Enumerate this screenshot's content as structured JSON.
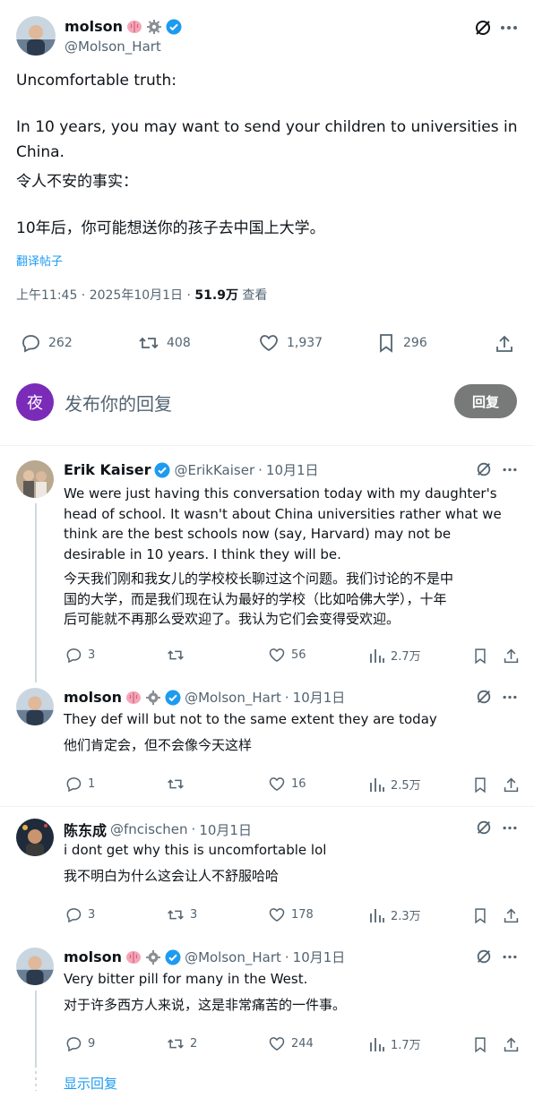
{
  "main_post": {
    "name": "molson",
    "handle": "@Molson_Hart",
    "text_en_1": "Uncomfortable truth:",
    "text_en_2a": "In 10 years, you may want to send your children to universities in",
    "text_en_2b": "China.",
    "text_zh_1": "令人不安的事实：",
    "text_zh_2": "10年后，你可能想送你的孩子去中国上大学。",
    "translate_label": "翻译帖子",
    "time": "上午11:45 · 2025年10月1日 · ",
    "views_count": "51.9万",
    "views_label": " 查看",
    "stats": {
      "replies": "262",
      "reposts": "408",
      "likes": "1,937",
      "bookmarks": "296"
    }
  },
  "reply_box": {
    "avatar_char": "夜",
    "placeholder": "发布你的回复",
    "button": "回复"
  },
  "replies": [
    {
      "name": "Erik Kaiser",
      "handle": "@ErikKaiser",
      "sep": "·",
      "date": "10月1日",
      "lines_en": [
        "We were just having this conversation today with my daughter's",
        "head of school. It wasn't about China universities rather what we",
        "think are the best schools now (say, Harvard) may not be",
        "desirable in 10 years. I think they will be."
      ],
      "lines_zh": [
        "今天我们刚和我女儿的学校校长聊过这个问题。我们讨论的不是中",
        "国的大学，而是我们现在认为最好的学校（比如哈佛大学），十年",
        "后可能就不再那么受欢迎了。我认为它们会变得受欢迎。"
      ],
      "stats": {
        "replies": "3",
        "reposts": "",
        "likes": "56",
        "views": "2.7万"
      }
    },
    {
      "name": "molson",
      "handle": "@Molson_Hart",
      "sep": "·",
      "date": "10月1日",
      "lines_en": [
        "They def will but not to the same extent they are today"
      ],
      "lines_zh": [
        "他们肯定会，但不会像今天这样"
      ],
      "stats": {
        "replies": "1",
        "reposts": "",
        "likes": "16",
        "views": "2.5万"
      }
    },
    {
      "name": "陈东成",
      "handle": "@fncischen",
      "sep": "·",
      "date": "10月1日",
      "lines_en": [
        "i dont get why this is uncomfortable lol"
      ],
      "lines_zh": [
        "我不明白为什么这会让人不舒服哈哈"
      ],
      "stats": {
        "replies": "3",
        "reposts": "3",
        "likes": "178",
        "views": "2.3万"
      }
    },
    {
      "name": "molson",
      "handle": "@Molson_Hart",
      "sep": "·",
      "date": "10月1日",
      "lines_en": [
        "Very bitter pill for many in the West."
      ],
      "lines_zh": [
        "对于许多西方人来说，这是非常痛苦的一件事。"
      ],
      "stats": {
        "replies": "9",
        "reposts": "2",
        "likes": "244",
        "views": "1.7万"
      }
    }
  ],
  "show_replies": "显示回复",
  "colors": {
    "verified": "#1d9bf0",
    "link": "#1d9bf0",
    "muted": "#536471",
    "reply_avatar": "#7a2bb8",
    "reply_button": "#787a7a"
  }
}
